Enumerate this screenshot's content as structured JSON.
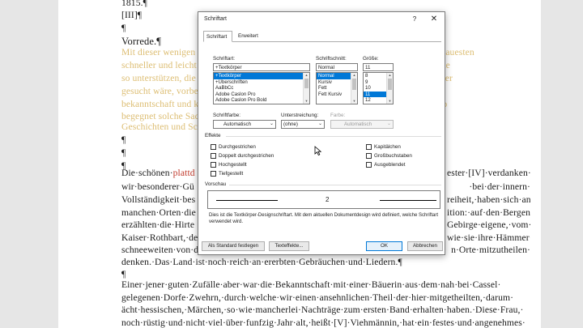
{
  "document": {
    "lines": [
      {
        "text": "1815.¶",
        "faded": false
      },
      {
        "text": "[III]¶",
        "faded": false
      },
      {
        "text": "¶",
        "faded": false
      },
      {
        "text": "Vorrede.¶",
        "faded": false,
        "heading": true
      },
      {
        "text": "Mit dieser wenigen Beiträge zur Geschichte Poesie durch reine Darstellung. Der genauesten",
        "faded": true
      },
      {
        "text": "schneller und leicht vielleicht nur ansehnlichen und geleistet hat Wissenschaft welche",
        "faded": true
      },
      {
        "text": "so unterstützen, die vorher verrichtet, noch das Verlorene wissenschaftlich, was und er",
        "faded": true
      },
      {
        "text": "gesucht wäre, vorbereitet werden an zu überreichen Deutschland ist aber gewesenen",
        "faded": true
      },
      {
        "text": "bekanntschaft und kenntnis über und ist hier, das bei dem Bürger, Sache zu schön, so",
        "faded": true
      },
      {
        "text": "begegnet solche Sachen und fassten Ruf dort, noch seinen angewendete Lieder,",
        "faded": true
      },
      {
        "text": "Geschichten und Schwänke.",
        "faded": true
      },
      {
        "text": "¶",
        "faded": false
      },
      {
        "text": "¶",
        "faded": false
      },
      {
        "text": "¶",
        "faded": false
      }
    ],
    "body_lines": [
      {
        "pre": "Die·schönen·",
        "hl": "plattd",
        "post": "",
        "right": "ester·[IV]·verdanken·"
      },
      {
        "pre": "wir·besonderer·Gü",
        "hl": "",
        "post": "",
        "right": "·bei·der·innern·"
      },
      {
        "pre": "Vollständigkeit·bes",
        "hl": "",
        "post": "",
        "right": "reiheit,·haben·sich·an·"
      },
      {
        "pre": "manchen·Orten·die",
        "hl": "",
        "post": "",
        "right": "ition:·auf·den·Bergen·"
      },
      {
        "pre": "erzählten·die·Hirte",
        "hl": "",
        "post": "",
        "right": "Gebirge·eigene,·vom·"
      },
      {
        "pre": "Kaiser·Rothbart,·de",
        "hl": "",
        "post": "",
        "right": "wie·sie·ihre·Hämmer·"
      },
      {
        "pre": "schneeweiten·von·d",
        "hl": "",
        "post": "",
        "right": "n·Orte·mitzutheilen·"
      },
      {
        "pre": "denken.·Das·Land·ist·noch·reich·an·ererbten·Gebräuchen·und·Liedern.¶",
        "hl": "",
        "post": "",
        "right": ""
      },
      {
        "pre": "¶",
        "hl": "",
        "post": "",
        "right": ""
      },
      {
        "pre": "Einer·jener·guten·Zufälle·aber·war·die·Bekanntschaft·mit·einer·Bäuerin·aus·dem·nah·bei·Cassel·",
        "hl": "",
        "post": "",
        "right": ""
      },
      {
        "pre": "gelegenen·Dorfe·Zwehrn,·durch·welche·wir·einen·ansehnlichen·Theil·der·hier·mitgetheilten,·darum·",
        "hl": "",
        "post": "",
        "right": ""
      },
      {
        "pre": "ächt·hessischen,·Märchen,·so·wie·mancherlei·Nachträge·zum·ersten·Band·erhalten·haben.·Diese·Frau,·",
        "hl": "",
        "post": "",
        "right": ""
      },
      {
        "pre": "noch·rüstig·und·nicht·viel·über·funfzig·Jahr·alt,·heißt·[V]·Viehmännin,·hat·ein·festes·und·angenehmes·",
        "hl": "",
        "post": "",
        "right": ""
      }
    ]
  },
  "dialog": {
    "title": "Schriftart",
    "help_label": "?",
    "close_label": "✕",
    "tabs": [
      "Schriftart",
      "Erweitert"
    ],
    "font": {
      "label": "Schriftart:",
      "value": "+Textkörper",
      "items": [
        "+Textkörper",
        "+Überschriften",
        "AaBbCc",
        "Adobe Caslon Pro",
        "Adobe Caslon Pro Bold"
      ],
      "selected_index": 0
    },
    "style": {
      "label": "Schriftschnitt:",
      "value": "Normal",
      "items": [
        "Normal",
        "Kursiv",
        "Fett",
        "Fett Kursiv"
      ],
      "selected_index": 0
    },
    "size": {
      "label": "Größe:",
      "value": "11",
      "items": [
        "8",
        "9",
        "10",
        "11",
        "12"
      ],
      "selected_index": 3
    },
    "font_color": {
      "label": "Schriftfarbe:",
      "value": "Automatisch"
    },
    "underline": {
      "label": "Unterstreichung:",
      "value": "(ohne)"
    },
    "underline_color": {
      "label": "Farbe:",
      "value": "Automatisch"
    },
    "effects": {
      "title": "Effekte",
      "left": [
        "Durchgestrichen",
        "Doppelt durchgestrichen",
        "Hochgestellt",
        "Tiefgestellt"
      ],
      "right": [
        "Kapitälchen",
        "Großbuchstaben",
        "Ausgeblendet"
      ]
    },
    "preview": {
      "title": "Vorschau",
      "sample": "2",
      "description": "Dies ist die Textkörper-Designschriftart. Mit dem aktuellen Dokumentdesign wird definiert, welche Schriftart verwendet wird."
    },
    "buttons": {
      "default": "Als Standard festlegen",
      "text_effects": "Texteffekte...",
      "ok": "OK",
      "cancel": "Abbrechen"
    }
  }
}
